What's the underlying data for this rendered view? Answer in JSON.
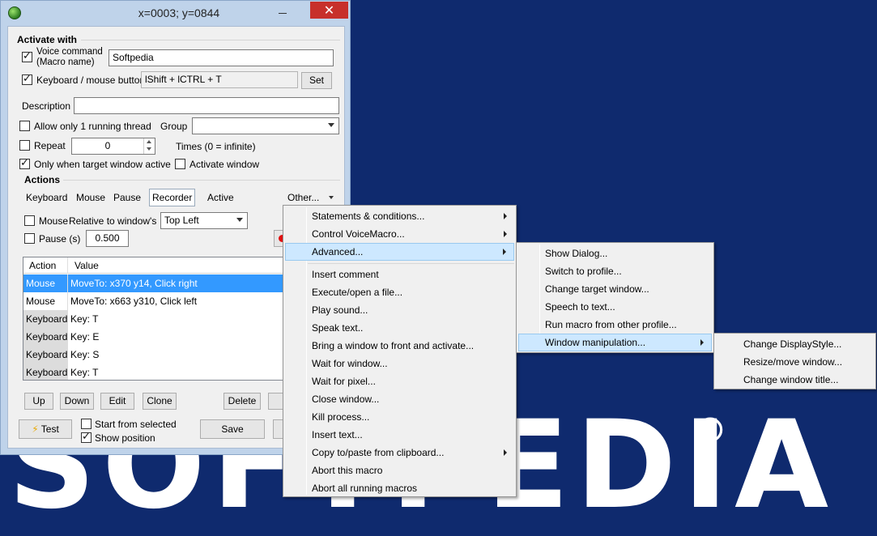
{
  "background": {
    "logo_text": "SOFTPEDIA",
    "registered": "®"
  },
  "window": {
    "title": "x=0003; y=0844",
    "close": "✕"
  },
  "activate": {
    "heading": "Activate with",
    "voice_label": "Voice command\n(Macro name)",
    "voice_value": "Softpedia",
    "keyboard_label": "Keyboard / mouse button",
    "keyboard_value": "lShift + lCTRL + T",
    "set_button": "Set"
  },
  "description": {
    "label": "Description",
    "value": ""
  },
  "allow_thread": "Allow only 1 running thread",
  "group": {
    "label": "Group",
    "value": ""
  },
  "repeat": {
    "label": "Repeat",
    "value": "0",
    "note": "Times (0 = infinite)"
  },
  "only_target": "Only when target window active",
  "activate_window": "Activate window",
  "actions": {
    "heading": "Actions",
    "tabs": [
      "Keyboard",
      "Mouse",
      "Pause",
      "Recorder",
      "Active"
    ],
    "other": "Other...",
    "mouse_label": "Mouse",
    "relative_label": "Relative to window's",
    "relative_value": "Top Left",
    "pause_label": "Pause (s)",
    "pause_value": "0.500"
  },
  "table": {
    "headers": [
      "Action",
      "Value"
    ],
    "rows": [
      {
        "action": "Mouse",
        "value": "MoveTo: x370 y14, Click right"
      },
      {
        "action": "Mouse",
        "value": "MoveTo: x663 y310, Click left"
      },
      {
        "action": "Keyboard",
        "value": "Key: T"
      },
      {
        "action": "Keyboard",
        "value": "Key: E"
      },
      {
        "action": "Keyboard",
        "value": "Key: S"
      },
      {
        "action": "Keyboard",
        "value": "Key: T"
      }
    ]
  },
  "row_buttons": [
    "Up",
    "Down",
    "Edit",
    "Clone",
    "Delete"
  ],
  "bottom": {
    "test": "Test",
    "start_from_selected": "Start from selected",
    "show_position": "Show position",
    "save": "Save"
  },
  "menu1": [
    {
      "label": "Statements & conditions...",
      "sub": true
    },
    {
      "label": "Control VoiceMacro...",
      "sub": true
    },
    {
      "label": "Advanced...",
      "sub": true
    },
    {
      "label": "Insert comment"
    },
    {
      "label": "Execute/open a file..."
    },
    {
      "label": "Play sound..."
    },
    {
      "label": "Speak text.."
    },
    {
      "label": "Bring a window to front and activate..."
    },
    {
      "label": "Wait for window..."
    },
    {
      "label": "Wait for pixel..."
    },
    {
      "label": "Close window..."
    },
    {
      "label": "Kill process..."
    },
    {
      "label": "Insert text..."
    },
    {
      "label": "Copy to/paste from clipboard...",
      "sub": true
    },
    {
      "label": "Abort this macro"
    },
    {
      "label": "Abort all running macros"
    }
  ],
  "menu2": [
    {
      "label": "Show Dialog..."
    },
    {
      "label": "Switch to profile..."
    },
    {
      "label": "Change target window..."
    },
    {
      "label": "Speech to text..."
    },
    {
      "label": "Run macro from other profile..."
    },
    {
      "label": "Window manipulation...",
      "sub": true
    }
  ],
  "menu3": [
    {
      "label": "Change DisplayStyle..."
    },
    {
      "label": "Resize/move window..."
    },
    {
      "label": "Change window title..."
    }
  ],
  "colors": {
    "selection": "#3399ff",
    "close_red": "#c7302b",
    "desktop": "#0f2a6e",
    "menu_highlight": "#cde8ff"
  }
}
